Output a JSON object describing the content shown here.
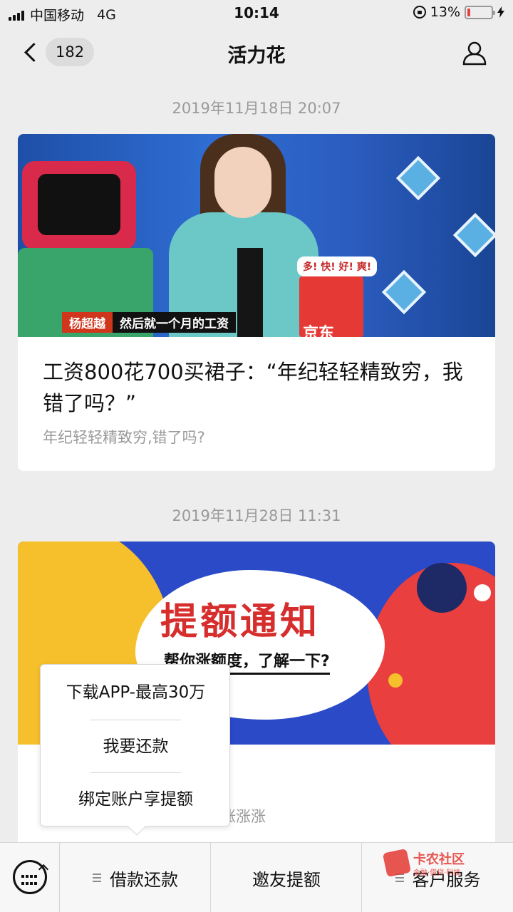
{
  "status_bar": {
    "carrier": "中国移动",
    "network": "4G",
    "time": "10:14",
    "battery_percent": "13%",
    "battery_level": 0.13,
    "battery_color": "#e64340"
  },
  "nav": {
    "unread_count": "182",
    "title": "活力花",
    "icons": {
      "back": "back-chevron-icon",
      "profile": "person-icon"
    }
  },
  "messages": [
    {
      "timestamp": "2019年11月18日 20:07",
      "title": "工资800花700买裙子：“年纪轻轻精致穷，我错了吗？”",
      "description": "年纪轻轻精致穷,错了吗?",
      "image": {
        "caption_name": "杨超越",
        "caption_text": "然后就一个月的工资",
        "jd_text": "京东",
        "bubble_text": "多! 快! 好! 爽!"
      }
    },
    {
      "timestamp": "2019年11月28日 11:31",
      "image": {
        "headline": "提额通知",
        "subline": "帮你涨额度，了解一下?"
      },
      "peek_text": "涨涨涨"
    }
  ],
  "popup_menu": {
    "items": [
      "下载APP-最高30万",
      "我要还款",
      "绑定账户享提额"
    ]
  },
  "bottom_bar": {
    "keyboard_icon": "keyboard-icon",
    "menus": [
      {
        "label": "借款还款",
        "has_submenu": true
      },
      {
        "label": "邀友提额",
        "has_submenu": false
      },
      {
        "label": "客户服务",
        "has_submenu": true
      }
    ]
  },
  "watermark": {
    "text": "卡农社区",
    "subtext": "金融·借贷·科技"
  }
}
